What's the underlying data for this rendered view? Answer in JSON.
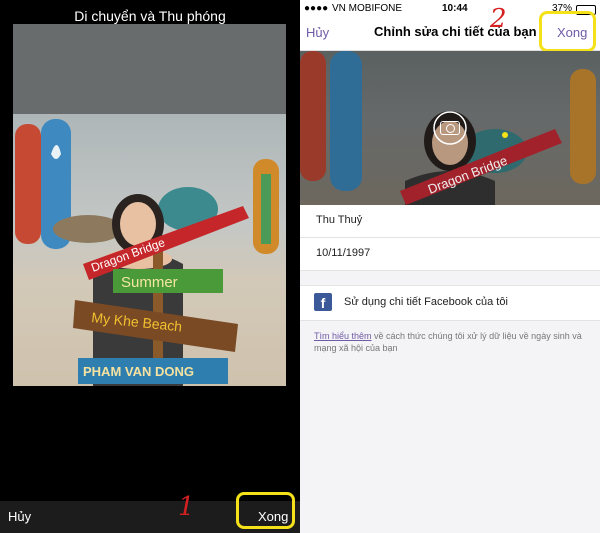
{
  "left_screen": {
    "title": "Di chuyển và Thu phóng",
    "cancel_label": "Hủy",
    "done_label": "Xong",
    "step_marker": "1",
    "photo": {
      "sign_lines": [
        "Dragon Bridge",
        "Summer",
        "My Khe Beach",
        "PHAM VAN DONG"
      ]
    }
  },
  "right_screen": {
    "status": {
      "carrier": "VN MOBIFONE",
      "time": "10:44",
      "battery": "37%"
    },
    "nav": {
      "cancel_label": "Hủy",
      "title": "Chỉnh sửa chi tiết của bạn",
      "done_label": "Xong"
    },
    "step_marker": "2",
    "photo": {
      "sign_text": "Dragon Bridge"
    },
    "name": "Thu Thuỷ",
    "birthday": "10/11/1997",
    "facebook_option": "Sử dụng chi tiết Facebook của tôi",
    "facebook_icon": "f",
    "info_link": "Tìm hiểu thêm",
    "info_text": " về cách thức chúng tôi xử lý dữ liệu về ngày sinh và mạng xã hội của bạn"
  },
  "colors": {
    "accent": "#6f5ba8",
    "highlight": "#f5e11a",
    "marker": "#d42020",
    "facebook": "#3b5998"
  }
}
